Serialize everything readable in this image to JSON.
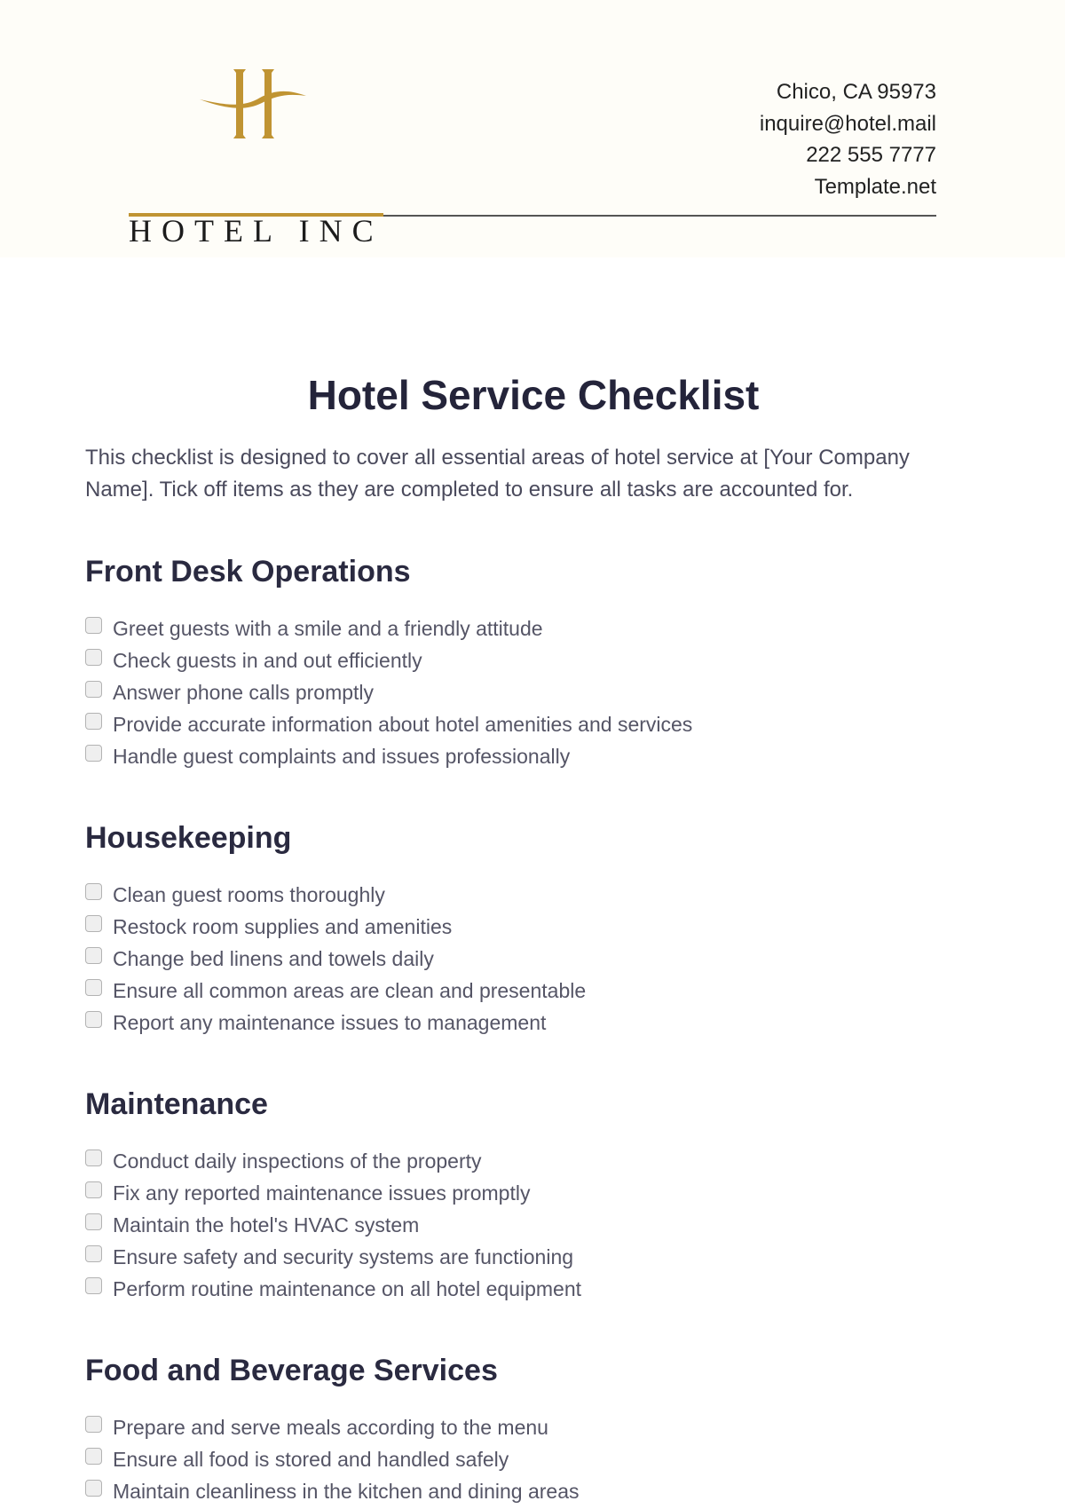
{
  "header": {
    "logo": {
      "mark": "H",
      "name": "HOTEL INC"
    },
    "contact": {
      "address": "Chico, CA 95973",
      "email": "inquire@hotel.mail",
      "phone": "222 555 7777",
      "website": "Template.net"
    },
    "colors": {
      "accent": "#c09433",
      "rule": "#555555",
      "background": "#fefdf8"
    }
  },
  "document": {
    "title": "Hotel Service Checklist",
    "intro": "This checklist is designed to cover all essential areas of hotel service at [Your Company Name]. Tick off items as they are completed to ensure all tasks are accounted for.",
    "sections": [
      {
        "heading": "Front Desk Operations",
        "items": [
          {
            "label": "Greet guests with a smile and a friendly attitude",
            "checked": false
          },
          {
            "label": "Check guests in and out efficiently",
            "checked": false
          },
          {
            "label": "Answer phone calls promptly",
            "checked": false
          },
          {
            "label": "Provide accurate information about hotel amenities and services",
            "checked": false
          },
          {
            "label": "Handle guest complaints and issues professionally",
            "checked": false
          }
        ]
      },
      {
        "heading": "Housekeeping",
        "items": [
          {
            "label": "Clean guest rooms thoroughly",
            "checked": false
          },
          {
            "label": "Restock room supplies and amenities",
            "checked": false
          },
          {
            "label": "Change bed linens and towels daily",
            "checked": false
          },
          {
            "label": "Ensure all common areas are clean and presentable",
            "checked": false
          },
          {
            "label": "Report any maintenance issues to management",
            "checked": false
          }
        ]
      },
      {
        "heading": "Maintenance",
        "items": [
          {
            "label": "Conduct daily inspections of the property",
            "checked": false
          },
          {
            "label": "Fix any reported maintenance issues promptly",
            "checked": false
          },
          {
            "label": "Maintain the hotel's HVAC system",
            "checked": false
          },
          {
            "label": "Ensure safety and security systems are functioning",
            "checked": false
          },
          {
            "label": "Perform routine maintenance on all hotel equipment",
            "checked": false
          }
        ]
      },
      {
        "heading": "Food and Beverage Services",
        "items": [
          {
            "label": "Prepare and serve meals according to the menu",
            "checked": false
          },
          {
            "label": "Ensure all food is stored and handled safely",
            "checked": false
          },
          {
            "label": "Maintain cleanliness in the kitchen and dining areas",
            "checked": false
          }
        ]
      }
    ]
  }
}
